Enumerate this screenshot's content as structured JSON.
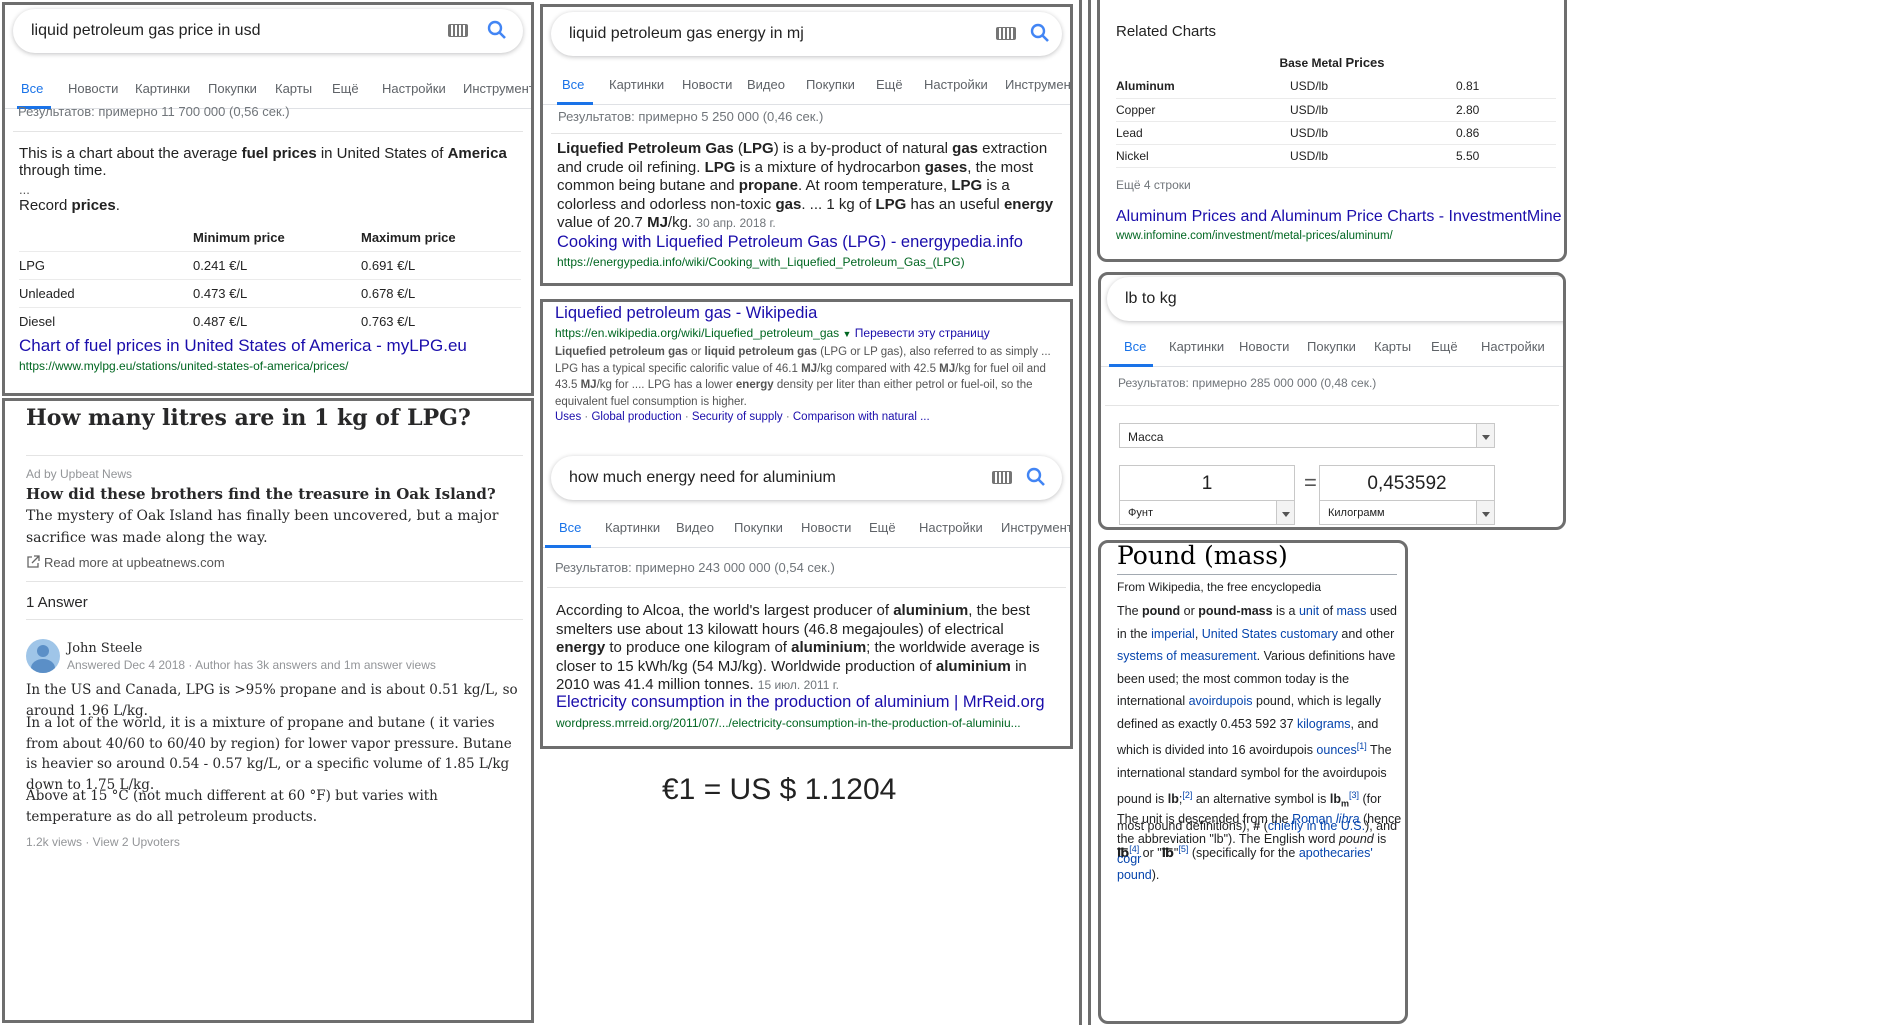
{
  "fuel_panel": {
    "query": "liquid petroleum gas price in usd",
    "tabs": [
      "Все",
      "Новости",
      "Картинки",
      "Покупки",
      "Карты",
      "Ещё",
      "Настройки",
      "Инструменты"
    ],
    "stats": "Результатов: примерно 11 700 000 (0,56 сек.)",
    "snippet_a1": "This is a chart about the average ",
    "snippet_b1": "fuel prices",
    "snippet_a2": " in United States of ",
    "snippet_b2": "America",
    "snippet_a3": " through time.",
    "ellipsis": "...",
    "record_a": "Record ",
    "record_b": "prices",
    "record_c": ".",
    "table_headers": [
      "Minimum price",
      "Maximum price"
    ],
    "rows": [
      {
        "fuel": "LPG",
        "min": "0.241 €/L",
        "max": "0.691 €/L"
      },
      {
        "fuel": "Unleaded",
        "min": "0.473 €/L",
        "max": "0.678 €/L"
      },
      {
        "fuel": "Diesel",
        "min": "0.487 €/L",
        "max": "0.763 €/L"
      }
    ],
    "link_title": "Chart of fuel prices in United States of America - myLPG.eu",
    "link_url": "https://www.mylpg.eu/stations/united-states-of-america/prices/"
  },
  "quora_panel": {
    "title": "How many litres are in 1 kg of LPG?",
    "ad_label": "Ad by Upbeat News",
    "ad_title": "How did these brothers find the treasure in Oak Island?",
    "ad_text": "The mystery of Oak Island has finally been uncovered, but a major sacrifice was made along the way.",
    "ad_link": "Read more at upbeatnews.com",
    "answers_count": "1 Answer",
    "author": "John Steele",
    "author_meta": "Answered Dec 4 2018 · Author has 3k answers and 1m answer views",
    "para1": "In the US and Canada, LPG is >95% propane and is about 0.51 kg/L, so around 1.96 L/kg.",
    "para2": "In a lot of the world, it is a mixture of propane and butane ( it varies from about 40/60 to 60/40 by region) for lower vapor pressure. Butane is heavier so around 0.54 - 0.57 kg/L, or a specific volume of 1.85 L/kg down to 1.75 L/kg.",
    "para3": "Above at 15 °C (not much different at 60 °F) but varies with temperature as do all petroleum products.",
    "footer": "1.2k views · View 2 Upvoters"
  },
  "energy_panel": {
    "query": "liquid petroleum gas energy in mj",
    "tabs": [
      "Все",
      "Картинки",
      "Новости",
      "Видео",
      "Покупки",
      "Ещё",
      "Настройки",
      "Инструменты"
    ],
    "stats": "Результатов: примерно 5 250 000 (0,46 сек.)",
    "s1": "Liquefied Petroleum Gas",
    "s2": " (",
    "s3": "LPG",
    "s4": ") is a by-product of natural ",
    "s5": "gas",
    "s6": " extraction and crude oil refining. ",
    "s7": "LPG",
    "s8": " is a mixture of hydrocarbon ",
    "s9": "gases",
    "s10": ", the most common being butane and ",
    "s11": "propane",
    "s12": ". At room temperature, ",
    "s13": "LPG",
    "s14": " is a colorless and odorless non-toxic ",
    "s15": "gas",
    "s16": ". ... 1 kg of ",
    "s17": "LPG",
    "s18": " has an useful ",
    "s19": "energy",
    "s20": " value of 20.7 ",
    "s21": "MJ",
    "s22": "/kg.",
    "date": "30 апр. 2018 г.",
    "link_title": "Cooking with Liquefied Petroleum Gas (LPG) - energypedia.info",
    "link_url": "https://energypedia.info/wiki/Cooking_with_Liquefied_Petroleum_Gas_(LPG)"
  },
  "wiki_result": {
    "title": "Liquefied petroleum gas - Wikipedia",
    "url": "https://en.wikipedia.org/wiki/Liquefied_petroleum_gas",
    "translate": "Перевести эту страницу",
    "w1": "Liquefied petroleum gas",
    "w2": " or ",
    "w3": "liquid petroleum gas",
    "w4": " (LPG or LP gas), also referred to as simply ... LPG has a typical specific calorific value of 46.1 ",
    "w5": "MJ",
    "w6": "/kg compared with 42.5 ",
    "w7": "MJ",
    "w8": "/kg for fuel oil and 43.5 ",
    "w9": "MJ",
    "w10": "/kg for .... LPG has a lower ",
    "w11": "energy",
    "w12": " density per liter than either petrol or fuel-oil, so the equivalent fuel consumption is higher.",
    "sitelinks": [
      "Uses",
      "Global production",
      "Security of supply",
      "Comparison with natural ..."
    ]
  },
  "aluminium_panel": {
    "query": "how much energy need for aluminium",
    "tabs": [
      "Все",
      "Картинки",
      "Видео",
      "Покупки",
      "Новости",
      "Ещё",
      "Настройки",
      "Инструменты"
    ],
    "stats": "Результатов: примерно 243 000 000 (0,54 сек.)",
    "a1": "According to Alcoa, the world's largest producer of ",
    "a2": "aluminium",
    "a3": ", the best smelters use about 13 kilowatt hours (46.8 megajoules) of electrical ",
    "a4": "energy",
    "a5": " to produce one kilogram of ",
    "a6": "aluminium",
    "a7": "; the worldwide average is closer to 15 kWh/kg (54 MJ/kg). Worldwide production of ",
    "a8": "aluminium",
    "a9": " in 2010 was 41.4 million tonnes.",
    "date": "15 июл. 2011 г.",
    "link_title": "Electricity consumption in the production of aluminium | MrReid.org",
    "link_url": "wordpress.mrreid.org/2011/07/.../electricity-consumption-in-the-production-of-aluminiu..."
  },
  "exchange": {
    "text": "€1 = US $ 1.1204"
  },
  "metal_panel": {
    "related": "Related Charts",
    "table_title_a": "Base Metal ",
    "table_title_b": "Prices",
    "rows": [
      {
        "metal": "Aluminum",
        "unit": "USD/lb",
        "price": "0.81"
      },
      {
        "metal": "Copper",
        "unit": "USD/lb",
        "price": "2.80"
      },
      {
        "metal": "Lead",
        "unit": "USD/lb",
        "price": "0.86"
      },
      {
        "metal": "Nickel",
        "unit": "USD/lb",
        "price": "5.50"
      }
    ],
    "more_rows": "Ещё 4 строки",
    "link_title": "Aluminum Prices and Aluminum Price Charts - InvestmentMine",
    "link_url": "www.infomine.com/investment/metal-prices/aluminum/"
  },
  "converter_panel": {
    "query": "lb to kg",
    "tabs": [
      "Все",
      "Картинки",
      "Новости",
      "Покупки",
      "Карты",
      "Ещё",
      "Настройки"
    ],
    "stats": "Результатов: примерно 285 000 000 (0,48 сек.)",
    "category": "Масса",
    "from_value": "1",
    "equals": "=",
    "to_value": "0,453592",
    "from_unit": "Фунт",
    "to_unit": "Килограмм"
  },
  "pound_panel": {
    "title": "Pound (mass)",
    "subtitle": "From Wikipedia, the free encyclopedia",
    "para1": [
      {
        "t": "The "
      },
      {
        "b": "pound"
      },
      {
        "t": " or "
      },
      {
        "b": "pound-mass"
      },
      {
        "t": " is a "
      },
      {
        "l": "unit"
      },
      {
        "t": " of "
      },
      {
        "l": "mass"
      },
      {
        "t": " used in the "
      },
      {
        "l": "imperial"
      },
      {
        "t": ", "
      },
      {
        "l": "United States customary"
      },
      {
        "t": " and other "
      },
      {
        "l": "systems of measurement"
      },
      {
        "t": ". Various definitions have been used; the most common today is the international "
      },
      {
        "l": "avoirdupois"
      },
      {
        "t": " pound, which is legally defined as exactly 0.453 592 37 "
      },
      {
        "l": "kilograms"
      },
      {
        "t": ", and which is divided into 16 avoirdupois "
      },
      {
        "l": "ounces"
      },
      {
        "sup": "[1]"
      },
      {
        "t": " The international standard symbol for the avoirdupois pound is "
      },
      {
        "b": "lb"
      },
      {
        "t": ";"
      },
      {
        "sup": "[2]"
      },
      {
        "t": " an alternative symbol is "
      },
      {
        "b": "lb"
      },
      {
        "sub": "m"
      },
      {
        "sup": "[3]"
      },
      {
        "t": " (for most pound definitions), "
      },
      {
        "b": "#"
      },
      {
        "t": " ("
      },
      {
        "l": "chiefly in the U.S."
      },
      {
        "t": "), and "
      },
      {
        "b": "℔"
      },
      {
        "sup": "[4]"
      },
      {
        "t": " or \""
      },
      {
        "b": "℔"
      },
      {
        "t": "\""
      },
      {
        "sup": "[5]"
      },
      {
        "t": " (specifically for the "
      },
      {
        "l": "apothecaries' pound"
      },
      {
        "t": ")."
      }
    ],
    "para2": [
      {
        "t": "The unit is descended from the "
      },
      {
        "l": "Roman"
      },
      {
        "t": " "
      },
      {
        "li": "libra"
      },
      {
        "t": " (hence the abbreviation \"lb\"). The English word "
      },
      {
        "i": "pound"
      },
      {
        "t": " is "
      },
      {
        "l": "cogr"
      }
    ]
  },
  "colors": {
    "link": "#1a0dab",
    "url": "#006621",
    "accent": "#1a73e8",
    "frame": "#6e6e6e"
  },
  "icons": [
    "keyboard-icon",
    "search-icon",
    "external-link-icon",
    "avatar"
  ]
}
